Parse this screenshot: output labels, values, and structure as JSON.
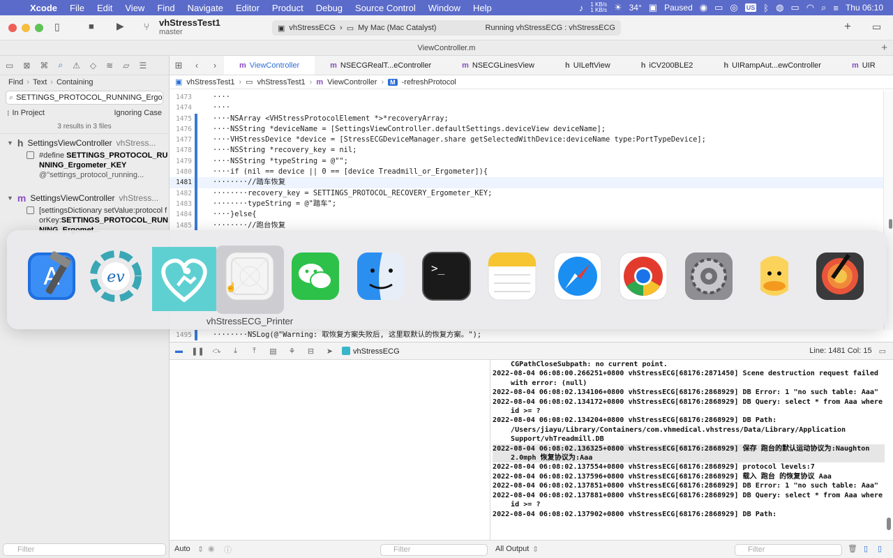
{
  "menubar": {
    "app_name": "Xcode",
    "items": [
      "File",
      "Edit",
      "View",
      "Find",
      "Navigate",
      "Editor",
      "Product",
      "Debug",
      "Source Control",
      "Window",
      "Help"
    ],
    "net_up": "1 KB/s",
    "net_down": "1 KB/s",
    "temperature": "34°",
    "media_status": "Paused",
    "input_source": "US",
    "clock": "Thu  06:10"
  },
  "toolbar": {
    "scheme_title": "vhStressTest1",
    "branch": "master",
    "scheme_target": "vhStressECG",
    "destination": "My Mac (Mac Catalyst)",
    "run_status": "Running vhStressECG : vhStressECG"
  },
  "doc_title": "ViewController.m",
  "navigator": {
    "find_path": [
      "Find",
      "Text",
      "Containing"
    ],
    "search_text": "SETTINGS_PROTOCOL_RUNNING_Ergo",
    "scope": "In Project",
    "case_mode": "Ignoring Case",
    "results_count": "3 results in 3 files",
    "results": [
      {
        "kind": "h",
        "file": "SettingsViewController",
        "path": "vhStress...",
        "match_prefix": "#define ",
        "match_strong": "SETTINGS_PROTOCOL_RUNNING_Ergometer_KEY",
        "match_sub": "@\"settings_protocol_running..."
      },
      {
        "kind": "m",
        "file": "SettingsViewController",
        "path": "vhStress...",
        "match_prefix": "[settingsDictionary setValue:protocol forKey:",
        "match_strong": "SETTINGS_PROTOCOL_RUNNING_Ergomet..."
      }
    ],
    "filter_placeholder": "Filter"
  },
  "editor": {
    "tabs": [
      {
        "kind": "m",
        "label": "ViewController",
        "active": true
      },
      {
        "kind": "m",
        "label": "NSECGRealT...eController",
        "active": false
      },
      {
        "kind": "m",
        "label": "NSECGLinesView",
        "active": false
      },
      {
        "kind": "h",
        "label": "UILeftView",
        "active": false
      },
      {
        "kind": "h",
        "label": "iCV200BLE2",
        "active": false
      },
      {
        "kind": "h",
        "label": "UIRampAut...ewController",
        "active": false
      },
      {
        "kind": "m",
        "label": "UIR",
        "active": false
      }
    ],
    "jump_bar": [
      "vhStressTest1",
      "vhStressTest1",
      "ViewController",
      "-refreshProtocol"
    ],
    "code_lines": [
      {
        "num": "1473",
        "text": "····",
        "bar": false,
        "current": false
      },
      {
        "num": "1474",
        "text": "····",
        "bar": false,
        "current": false
      },
      {
        "num": "1475",
        "text": "····NSArray <VHStressProtocolElement *>*recoveryArray;",
        "bar": true,
        "current": false
      },
      {
        "num": "1476",
        "text": "····NSString *deviceName = [SettingsViewController.defaultSettings.deviceView deviceName];",
        "bar": true,
        "current": false
      },
      {
        "num": "1477",
        "text": "····VHStressDevice *device = [StressECGDeviceManager.share getSelectedWithDevice:deviceName type:PortTypeDevice];",
        "bar": true,
        "current": false
      },
      {
        "num": "1478",
        "text": "····NSString *recovery_key = nil;",
        "bar": true,
        "current": false
      },
      {
        "num": "1479",
        "text": "····NSString *typeString = @\"\";",
        "bar": true,
        "current": false
      },
      {
        "num": "1480",
        "text": "····if (nil == device || 0 == [device Treadmill_or_Ergometer]){",
        "bar": true,
        "current": false
      },
      {
        "num": "1481",
        "text": "········//踏车恢复",
        "bar": true,
        "current": true
      },
      {
        "num": "1482",
        "text": "········recovery_key = SETTINGS_PROTOCOL_RECOVERY_Ergometer_KEY;",
        "bar": true,
        "current": false
      },
      {
        "num": "1483",
        "text": "········typeString = @\"踏车\";",
        "bar": true,
        "current": false
      },
      {
        "num": "1484",
        "text": "····}else{",
        "bar": true,
        "current": false
      },
      {
        "num": "1485",
        "text": "········//跑台恢复",
        "bar": true,
        "current": false
      }
    ],
    "visible_line_below": {
      "num": "1495",
      "text": "········NSLog(@\"Warning: 取恢复方案失败后, 这里取默认的恢复方案。\");"
    }
  },
  "app_switcher": {
    "apps": [
      "Xcode",
      "EV",
      "vhStressECG",
      "vhStressECG_Printer",
      "WeChat",
      "Finder",
      "Terminal",
      "Notes",
      "Safari",
      "Google Chrome",
      "System Preferences",
      "Cyberduck",
      "Digital Color Meter"
    ],
    "selected_label": "vhStressECG_Printer"
  },
  "debug": {
    "target": "vhStressECG",
    "line_col": "Line: 1481  Col: 15",
    "console_lines": [
      {
        "text": "CGPathCloseSubpath: no current point.",
        "hl": false,
        "indent": true
      },
      {
        "text": "2022-08-04 06:08:00.266251+0800 vhStressECG[68176:2871450] Scene destruction request failed with error: (null)",
        "hl": false
      },
      {
        "text": "2022-08-04 06:08:02.134106+0800 vhStressECG[68176:2868929] DB Error: 1 \"no such table: Aaa\"",
        "hl": false
      },
      {
        "text": "2022-08-04 06:08:02.134172+0800 vhStressECG[68176:2868929] DB Query: select * from Aaa where id >= ?",
        "hl": false
      },
      {
        "text": "2022-08-04 06:08:02.134204+0800 vhStressECG[68176:2868929] DB Path: /Users/jiayu/Library/Containers/com.vhmedical.vhstress/Data/Library/Application Support/vhTreadmill.DB",
        "hl": false
      },
      {
        "text": "2022-08-04 06:08:02.136325+0800 vhStressECG[68176:2868929] 保存 跑台的默认运动协议为:Naughton 2.0mph 恢复协议为:Aaa",
        "hl": true
      },
      {
        "text": "2022-08-04 06:08:02.137554+0800 vhStressECG[68176:2868929] protocol levels:7",
        "hl": false
      },
      {
        "text": "2022-08-04 06:08:02.137596+0800 vhStressECG[68176:2868929] 载入 跑台 的恢复协议 Aaa",
        "hl": false
      },
      {
        "text": "2022-08-04 06:08:02.137851+0800 vhStressECG[68176:2868929] DB Error: 1 \"no such table: Aaa\"",
        "hl": false
      },
      {
        "text": "2022-08-04 06:08:02.137881+0800 vhStressECG[68176:2868929] DB Query: select * from Aaa where id >= ?",
        "hl": false
      },
      {
        "text": "2022-08-04 06:08:02.137902+0800 vhStressECG[68176:2868929] DB Path:",
        "hl": false
      }
    ],
    "auto_label": "Auto",
    "output_label": "All Output",
    "filter_placeholder": "Filter"
  }
}
